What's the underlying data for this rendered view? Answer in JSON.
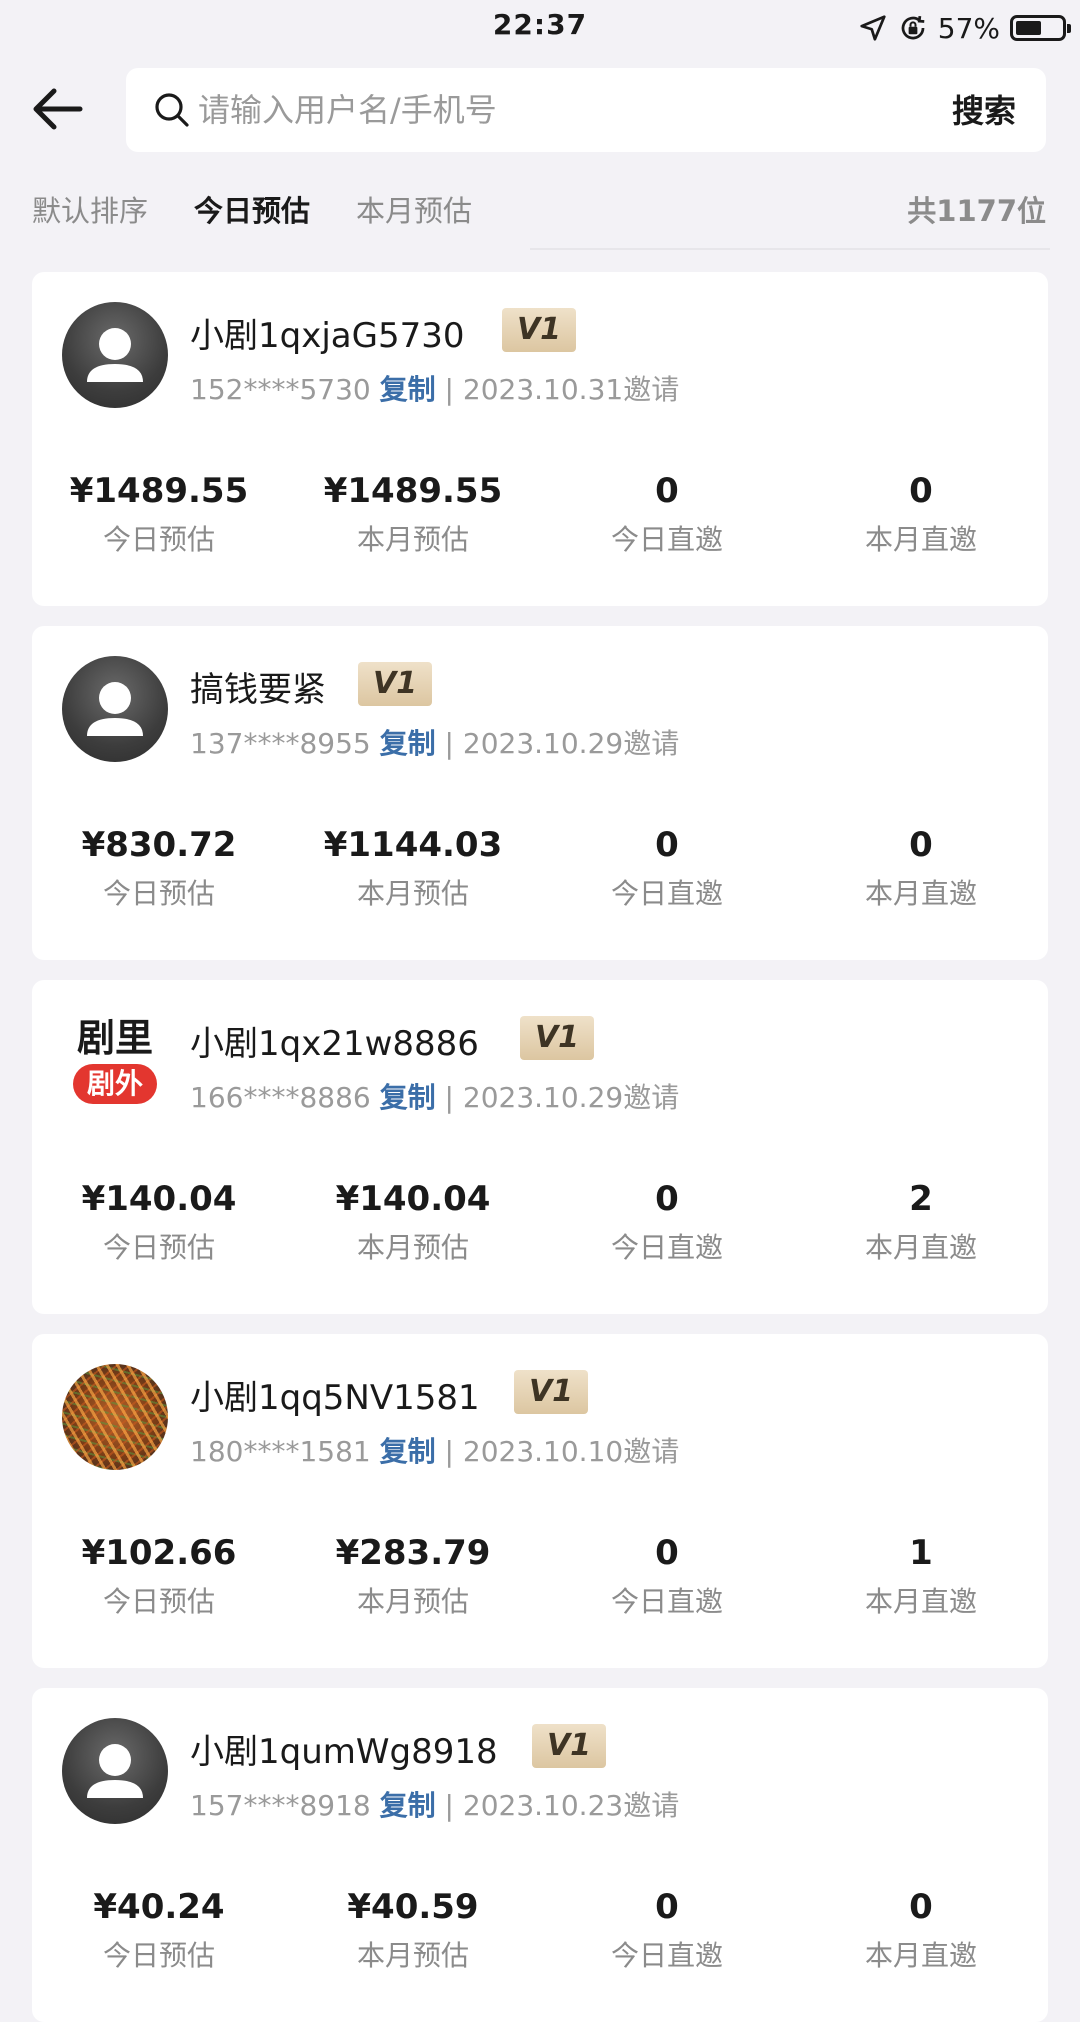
{
  "status_bar": {
    "time": "22:37",
    "battery_percent": "57%",
    "battery_level": 0.57,
    "icons": [
      "location-arrow-icon",
      "rotation-lock-icon",
      "battery-icon"
    ]
  },
  "header": {
    "back_icon": "arrow-left-icon",
    "search": {
      "icon": "search-icon",
      "placeholder": "请输入用户名/手机号",
      "value": "",
      "button_label": "搜索"
    }
  },
  "sort": {
    "tabs": [
      {
        "label": "默认排序",
        "active": false
      },
      {
        "label": "今日预估",
        "active": true
      },
      {
        "label": "本月预估",
        "active": false
      }
    ],
    "total": "共1177位"
  },
  "colors": {
    "background": "#f3f2f6",
    "card": "#ffffff",
    "copy_link": "#3b6ea8",
    "badge": "#e4d1b1",
    "logo_red": "#e3362f"
  },
  "members": [
    {
      "avatar": "default-user-icon",
      "name": "小剧1qxjaG5730",
      "level": "V1",
      "phone": "152****5730",
      "copy_label": "复制",
      "separator": "|",
      "invite": "2023.10.31邀请",
      "stats": [
        {
          "value": "¥1489.55",
          "label": "今日预估"
        },
        {
          "value": "¥1489.55",
          "label": "本月预估"
        },
        {
          "value": "0",
          "label": "今日直邀"
        },
        {
          "value": "0",
          "label": "本月直邀"
        }
      ]
    },
    {
      "avatar": "default-user-icon",
      "name": "搞钱要紧",
      "level": "V1",
      "phone": "137****8955",
      "copy_label": "复制",
      "separator": "|",
      "invite": "2023.10.29邀请",
      "stats": [
        {
          "value": "¥830.72",
          "label": "今日预估"
        },
        {
          "value": "¥1144.03",
          "label": "本月预估"
        },
        {
          "value": "0",
          "label": "今日直邀"
        },
        {
          "value": "0",
          "label": "本月直邀"
        }
      ]
    },
    {
      "avatar": "app-logo",
      "logo_top": "剧里",
      "logo_bottom": "剧外",
      "name": "小剧1qx21w8886",
      "level": "V1",
      "phone": "166****8886",
      "copy_label": "复制",
      "separator": "|",
      "invite": "2023.10.29邀请",
      "stats": [
        {
          "value": "¥140.04",
          "label": "今日预估"
        },
        {
          "value": "¥140.04",
          "label": "本月预估"
        },
        {
          "value": "0",
          "label": "今日直邀"
        },
        {
          "value": "2",
          "label": "本月直邀"
        }
      ]
    },
    {
      "avatar": "food-photo",
      "name": "小剧1qq5NV1581",
      "level": "V1",
      "phone": "180****1581",
      "copy_label": "复制",
      "separator": "|",
      "invite": "2023.10.10邀请",
      "stats": [
        {
          "value": "¥102.66",
          "label": "今日预估"
        },
        {
          "value": "¥283.79",
          "label": "本月预估"
        },
        {
          "value": "0",
          "label": "今日直邀"
        },
        {
          "value": "1",
          "label": "本月直邀"
        }
      ]
    },
    {
      "avatar": "default-user-icon",
      "name": "小剧1qumWg8918",
      "level": "V1",
      "phone": "157****8918",
      "copy_label": "复制",
      "separator": "|",
      "invite": "2023.10.23邀请",
      "stats": [
        {
          "value": "¥40.24",
          "label": "今日预估"
        },
        {
          "value": "¥40.59",
          "label": "本月预估"
        },
        {
          "value": "0",
          "label": "今日直邀"
        },
        {
          "value": "0",
          "label": "本月直邀"
        }
      ]
    }
  ]
}
